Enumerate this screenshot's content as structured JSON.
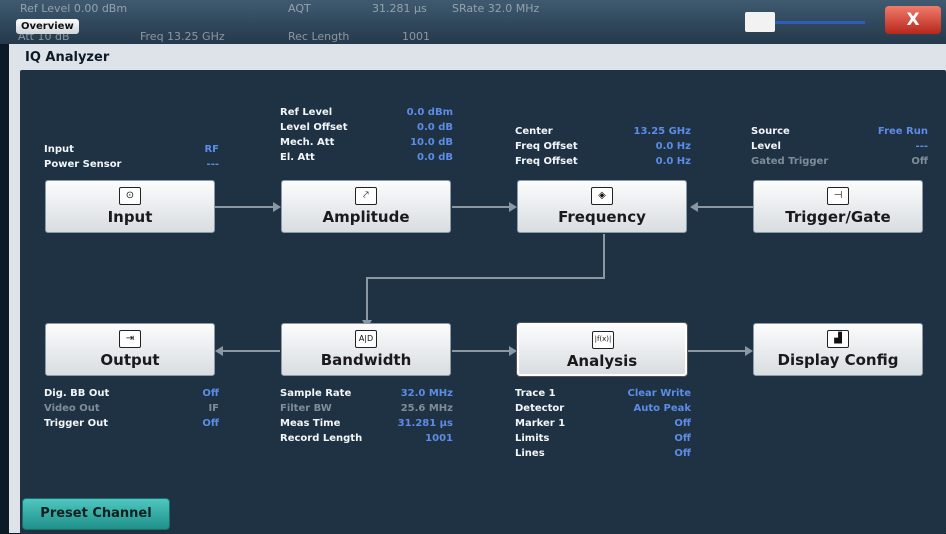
{
  "status_bar": {
    "tab": "Overview",
    "ref_level": "0.00 dBm",
    "att": "10 dB",
    "freq": "Freq 13.25 GHz",
    "aqt_label": "AQT",
    "aqt_value": "31.281 µs",
    "srate_label": "SRate",
    "srate_value": "32.0 MHz",
    "rec_length": "Rec Length",
    "rec_length_value": "1001",
    "close": "X"
  },
  "dialog": {
    "title": "IQ Analyzer"
  },
  "blocks": {
    "input": {
      "label": "Input",
      "icon": "input-icon",
      "symbol": "⊙"
    },
    "amplitude": {
      "label": "Amplitude",
      "icon": "amplitude-icon",
      "symbol": "⤤"
    },
    "frequency": {
      "label": "Frequency",
      "icon": "frequency-icon",
      "symbol": "◈"
    },
    "trigger": {
      "label": "Trigger/Gate",
      "icon": "trigger-icon",
      "symbol": "⊣"
    },
    "output": {
      "label": "Output",
      "icon": "output-icon",
      "symbol": "⇥"
    },
    "bandwidth": {
      "label": "Bandwidth",
      "icon": "ad-converter-icon",
      "symbol": "A|D"
    },
    "analysis": {
      "label": "Analysis",
      "icon": "analysis-icon",
      "symbol": "|f(x)|"
    },
    "display": {
      "label": "Display Config",
      "icon": "display-config-icon",
      "symbol": "▟"
    }
  },
  "params": {
    "input": [
      {
        "label": "Input",
        "value": "RF"
      },
      {
        "label": "Power Sensor",
        "value": "---"
      }
    ],
    "amplitude": [
      {
        "label": "Ref Level",
        "value": "0.0 dBm"
      },
      {
        "label": "Level Offset",
        "value": "0.0 dB"
      },
      {
        "label": "Mech. Att",
        "value": "10.0 dB"
      },
      {
        "label": "El. Att",
        "value": "0.0 dB"
      }
    ],
    "frequency": [
      {
        "label": "Center",
        "value": "13.25 GHz"
      },
      {
        "label": "Freq Offset",
        "value": "0.0 Hz"
      },
      {
        "label": "Freq Offset",
        "value": "0.0 Hz"
      }
    ],
    "trigger": [
      {
        "label": "Source",
        "value": "Free Run"
      },
      {
        "label": "Level",
        "value": "---"
      },
      {
        "label": "Gated Trigger",
        "value": "Off"
      }
    ],
    "output": [
      {
        "label": "Dig. BB Out",
        "value": "Off"
      },
      {
        "label": "Video Out",
        "value": "IF"
      },
      {
        "label": "Trigger Out",
        "value": "Off"
      }
    ],
    "bandwidth": [
      {
        "label": "Sample Rate",
        "value": "32.0 MHz"
      },
      {
        "label": "Filter BW",
        "value": "25.6 MHz"
      },
      {
        "label": "Meas Time",
        "value": "31.281 µs"
      },
      {
        "label": "Record Length",
        "value": "1001"
      }
    ],
    "analysis": [
      {
        "label": "Trace 1",
        "value": "Clear Write"
      },
      {
        "label": "Detector",
        "value": "Auto Peak"
      },
      {
        "label": "Marker 1",
        "value": "Off"
      },
      {
        "label": "Limits",
        "value": "Off"
      },
      {
        "label": "Lines",
        "value": "Off"
      }
    ]
  },
  "preset_button": "Preset Channel"
}
